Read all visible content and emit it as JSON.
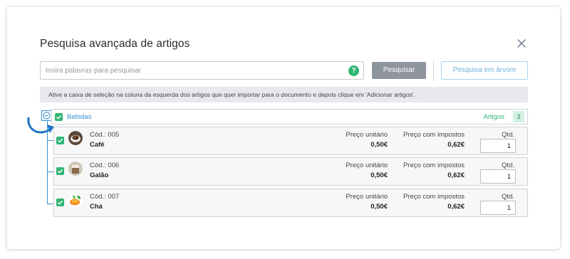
{
  "dialog": {
    "title": "Pesquisa avançada de artigos",
    "close_icon": "close-icon"
  },
  "search": {
    "placeholder": "Insira palavras para pesquisar",
    "value": "",
    "help_symbol": "?",
    "search_button": "Pesquisar",
    "tree_button": "Pesquisa em árvore"
  },
  "info": {
    "text": "Ative a caixa de seleção na coluna da esquerda dos artigos que quer importar para o documento e depois clique em 'Adicionar artigos'."
  },
  "category": {
    "name": "Bebidas",
    "checked": true,
    "count_label": "Artigos",
    "count": "3"
  },
  "columns": {
    "unit_price": "Preço unitário",
    "price_tax": "Preço com impostos",
    "qty": "Qtd."
  },
  "items": [
    {
      "code": "Cód.: 005",
      "name": "Café",
      "unit_price": "0,50€",
      "price_tax": "0,62€",
      "qty": "1",
      "checked": true,
      "image": "coffee-cup-image"
    },
    {
      "code": "Cód.: 006",
      "name": "Galão",
      "unit_price": "0,50€",
      "price_tax": "0,62€",
      "qty": "1",
      "checked": true,
      "image": "galao-cup-image"
    },
    {
      "code": "Cód.: 007",
      "name": "Chá",
      "unit_price": "0,50€",
      "price_tax": "0,62€",
      "qty": "1",
      "checked": true,
      "image": "tea-image"
    }
  ],
  "colors": {
    "accent_green": "#2fb673",
    "accent_blue": "#3a8fd0",
    "button_gray": "#8e959c",
    "info_bar": "#e8e9ec"
  }
}
